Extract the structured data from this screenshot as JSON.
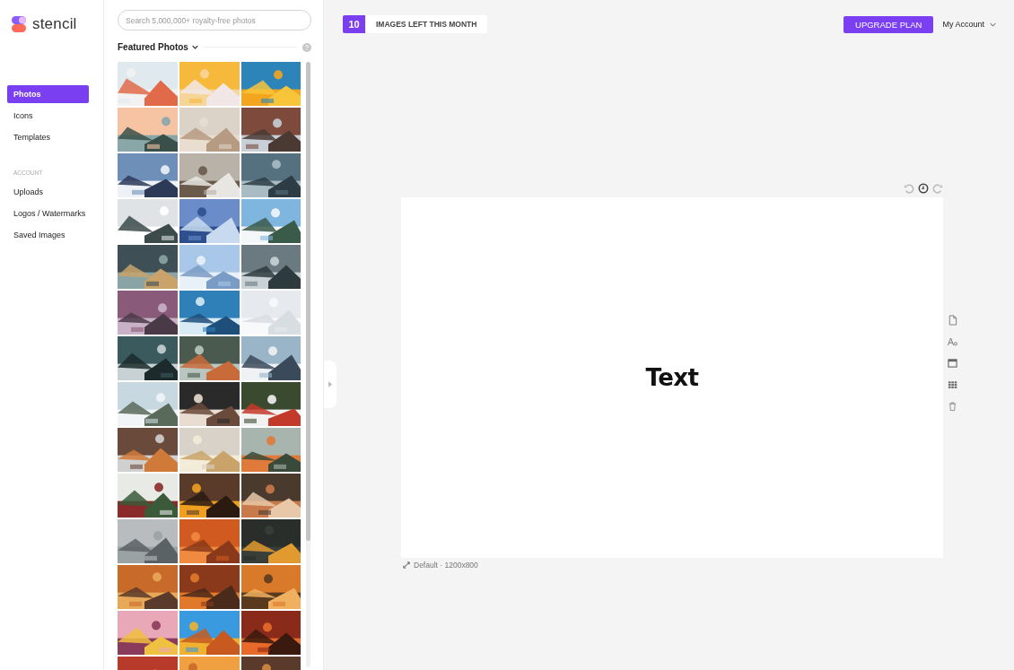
{
  "logo": {
    "name": "stencil"
  },
  "nav": [
    {
      "label": "Photos",
      "selected": true
    },
    {
      "label": "Icons",
      "selected": false
    },
    {
      "label": "Templates",
      "selected": false
    }
  ],
  "account_section": {
    "heading": "ACCOUNT",
    "items": [
      {
        "label": "Uploads"
      },
      {
        "label": "Logos / Watermarks"
      },
      {
        "label": "Saved Images"
      }
    ]
  },
  "search": {
    "placeholder": "Search 5,000,000+ royalty-free photos"
  },
  "photos_panel": {
    "title": "Featured Photos"
  },
  "quota": {
    "count": "10",
    "label": "IMAGES LEFT THIS MONTH"
  },
  "upgrade_button": "UPGRADE PLAN",
  "account_menu": "My Account",
  "canvas": {
    "text": "Text",
    "size_label": "Default · 1200x800"
  }
}
